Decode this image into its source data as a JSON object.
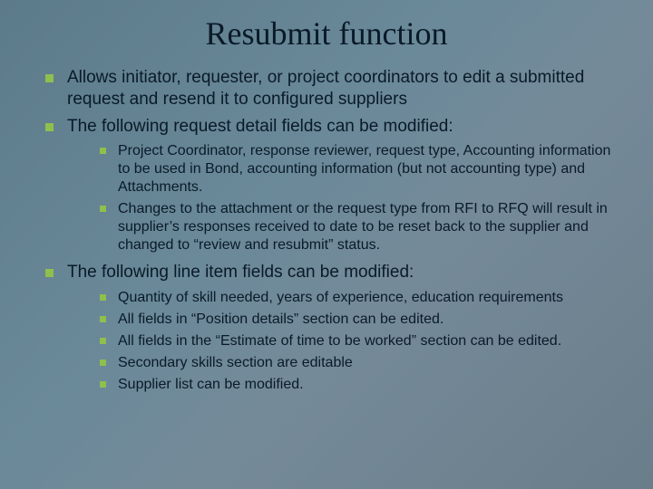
{
  "title": "Resubmit function",
  "level1": [
    {
      "text": "Allows initiator, requester, or project coordinators to edit a submitted request and resend it to configured suppliers",
      "children": []
    },
    {
      "text": "The following request detail fields can be modified:",
      "children": [
        "Project Coordinator, response reviewer, request type, Accounting information to be used in Bond, accounting information (but not accounting type) and Attachments.",
        "Changes to the attachment or the request type from RFI to RFQ will result in supplier’s responses received to date to be reset back to the supplier and changed to “review and resubmit” status."
      ]
    },
    {
      "text": "The following line item fields can be modified:",
      "children": [
        "Quantity of skill needed, years of experience, education requirements",
        "All fields in “Position details” section can be edited.",
        "All fields in the “Estimate of time to be worked” section can be edited.",
        "Secondary skills section are editable",
        "Supplier list can be modified."
      ]
    }
  ]
}
